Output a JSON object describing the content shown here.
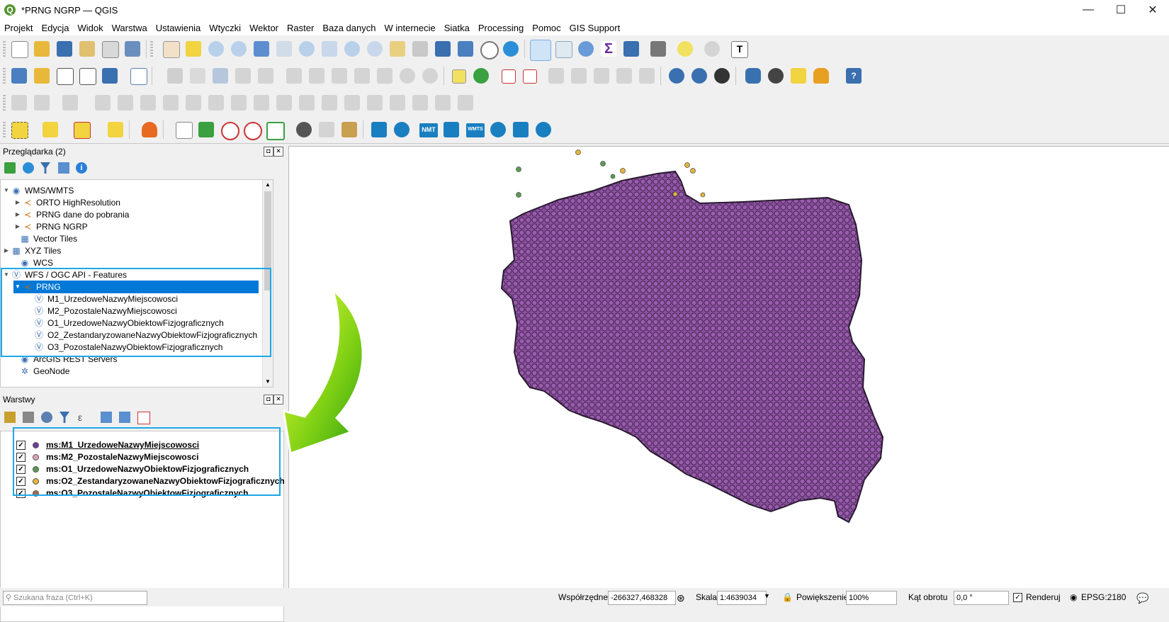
{
  "window": {
    "title": "*PRNG NGRP — QGIS",
    "controls": {
      "minimize": "—",
      "maximize": "☐",
      "close": "✕"
    }
  },
  "menu": [
    "Projekt",
    "Edycja",
    "Widok",
    "Warstwa",
    "Ustawienia",
    "Wtyczki",
    "Wektor",
    "Raster",
    "Baza danych",
    "W internecie",
    "Siatka",
    "Processing",
    "Pomoc",
    "GIS Support"
  ],
  "toolbar_labels": {
    "nmt": "NMT",
    "wmts": "WMTS"
  },
  "browser": {
    "title": "Przeglądarka (2)",
    "items": [
      {
        "label": "WMS/WMTS",
        "icon": "globe-icon"
      },
      {
        "label": "ORTO HighResolution",
        "icon": "connection-icon"
      },
      {
        "label": "PRNG dane do pobrania",
        "icon": "connection-icon"
      },
      {
        "label": "PRNG NGRP",
        "icon": "connection-icon"
      },
      {
        "label": "Vector Tiles",
        "icon": "grid-icon"
      },
      {
        "label": "XYZ Tiles",
        "icon": "grid-icon"
      },
      {
        "label": "WCS",
        "icon": "globe-icon"
      },
      {
        "label": "WFS / OGC API - Features",
        "icon": "wfs-icon"
      },
      {
        "label": "PRNG",
        "icon": "connection-icon"
      },
      {
        "label": "M1_UrzedoweNazwyMiejscowosci",
        "icon": "wfs-icon"
      },
      {
        "label": "M2_PozostaleNazwyMiejscowosci",
        "icon": "wfs-icon"
      },
      {
        "label": "O1_UrzedoweNazwyObiektowFizjograficznych",
        "icon": "wfs-icon"
      },
      {
        "label": "O2_ZestandaryzowaneNazwyObiektowFizjograficznych",
        "icon": "wfs-icon"
      },
      {
        "label": "O3_PozostaleNazwyObiektowFizjograficznych",
        "icon": "wfs-icon"
      },
      {
        "label": "ArcGIS REST Servers",
        "icon": "globe-icon"
      },
      {
        "label": "GeoNode",
        "icon": "geonode-icon"
      }
    ]
  },
  "layers": {
    "title": "Warstwy",
    "items": [
      {
        "label": "ms:M1_UrzedoweNazwyMiejscowosci",
        "color": "#6a3d9a",
        "checked": "✓"
      },
      {
        "label": "ms:M2_PozostaleNazwyMiejscowosci",
        "color": "#d9a5b3",
        "checked": "✓"
      },
      {
        "label": "ms:O1_UrzedoweNazwyObiektowFizjograficznych",
        "color": "#5a9a52",
        "checked": "✓"
      },
      {
        "label": "ms:O2_ZestandaryzowaneNazwyObiektowFizjograficznych",
        "color": "#e3b53a",
        "checked": "✓"
      },
      {
        "label": "ms:O3_PozostaleNazwyObiektowFizjograficznych",
        "color": "#a86a4a",
        "checked": "✓"
      }
    ]
  },
  "colors": {
    "accent": "#1ea7e8",
    "selection": "#0078d7",
    "map_fill": "#8a50a0",
    "arrow_green": "#7fd014"
  },
  "status": {
    "search_placeholder": "Szukana fraza (Ctrl+K)",
    "coords_label": "Współrzędne",
    "coords_value": "-266327,468328",
    "scale_label": "Skala",
    "scale_value": "1:4639034",
    "zoom_label": "Powiększenie",
    "zoom_value": "100%",
    "rotation_label": "Kąt obrotu",
    "rotation_value": "0,0 °",
    "render_label": "Renderuj",
    "render_checked": "✓",
    "crs": "EPSG:2180"
  }
}
